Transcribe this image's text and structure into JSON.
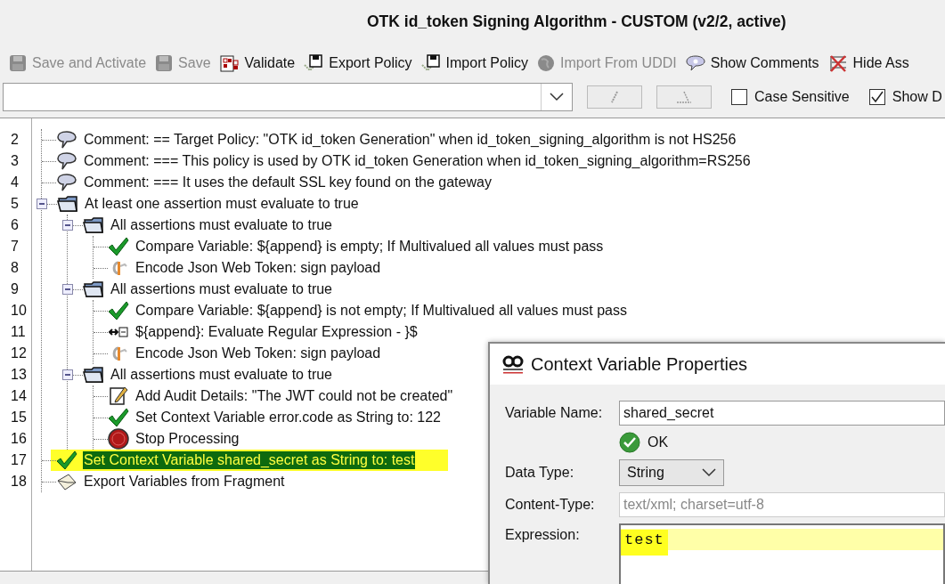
{
  "window": {
    "title": "OTK id_token Signing Algorithm - CUSTOM (v2/2, active)"
  },
  "toolbar": [
    {
      "label": "Save and Activate",
      "disabled": true
    },
    {
      "label": "Save",
      "disabled": true
    },
    {
      "label": "Validate",
      "disabled": false
    },
    {
      "label": "Export Policy",
      "disabled": false
    },
    {
      "label": "Import Policy",
      "disabled": false
    },
    {
      "label": "Import From UDDI",
      "disabled": true
    },
    {
      "label": "Show Comments",
      "disabled": false
    },
    {
      "label": "Hide Ass",
      "disabled": false
    }
  ],
  "search": {
    "buttons": [
      {
        "kind": "next",
        "disabled": true
      },
      {
        "kind": "previous",
        "disabled": true
      }
    ],
    "options": [
      {
        "label": "Case Sensitive",
        "checked": false
      },
      {
        "label": "Show D",
        "checked": true
      }
    ]
  },
  "tree": {
    "items": [
      {
        "line": "2",
        "kind": "comment",
        "text": "Comment: == Target Policy: \"OTK id_token Generation\" when id_token_signing_algorithm is not HS256",
        "selected": false
      },
      {
        "line": "3",
        "kind": "comment",
        "text": "Comment: === This policy is used by OTK id_token Generation when id_token_signing_algorithm=RS256",
        "selected": false
      },
      {
        "line": "4",
        "kind": "comment",
        "text": "Comment: === It uses the default SSL key found on the gateway",
        "selected": false
      },
      {
        "line": "5",
        "kind": "folder",
        "text": "At least one assertion must evaluate to true",
        "selected": false,
        "expanded": true,
        "children": [
          {
            "line": "6",
            "kind": "folder",
            "text": "All assertions must evaluate to true",
            "selected": false,
            "expanded": true,
            "children": [
              {
                "line": "7",
                "kind": "check",
                "text": "Compare Variable: ${append} is empty; If Multivalued all values must pass",
                "selected": false
              },
              {
                "line": "8",
                "kind": "jwt",
                "text": "Encode Json Web Token: sign payload",
                "selected": false
              }
            ]
          },
          {
            "line": "9",
            "kind": "folder",
            "text": "All assertions must evaluate to true",
            "selected": false,
            "expanded": true,
            "children": [
              {
                "line": "10",
                "kind": "check",
                "text": "Compare Variable: ${append} is not empty; If Multivalued all values must pass",
                "selected": false
              },
              {
                "line": "11",
                "kind": "regex",
                "text": "${append}: Evaluate Regular Expression - }$",
                "selected": false
              },
              {
                "line": "12",
                "kind": "jwt",
                "text": "Encode Json Web Token: sign payload",
                "selected": false
              }
            ]
          },
          {
            "line": "13",
            "kind": "folder",
            "text": "All assertions must evaluate to true",
            "selected": false,
            "expanded": true,
            "children": [
              {
                "line": "14",
                "kind": "audit",
                "text": "Add Audit Details: \"The JWT could not be created\"",
                "selected": false
              },
              {
                "line": "15",
                "kind": "check",
                "text": "Set Context Variable error.code as String to: 122",
                "selected": false
              },
              {
                "line": "16",
                "kind": "stop",
                "text": "Stop Processing",
                "selected": false
              }
            ]
          }
        ]
      },
      {
        "line": "17",
        "kind": "check",
        "text": "Set Context Variable shared_secret as String to: test",
        "selected": true
      },
      {
        "line": "18",
        "kind": "export",
        "text": "Export Variables from Fragment",
        "selected": false
      }
    ]
  },
  "dialog": {
    "title": "Context Variable Properties",
    "variable_name": {
      "label": "Variable Name:",
      "value": "shared_secret"
    },
    "validation": {
      "kind": "ok",
      "text": "OK"
    },
    "data_type": {
      "label": "Data Type:",
      "value": "String"
    },
    "content_type": {
      "label": "Content-Type:",
      "placeholder": "text/xml; charset=utf-8",
      "disabled": true
    },
    "expression": {
      "label": "Expression:",
      "value": "test"
    }
  }
}
